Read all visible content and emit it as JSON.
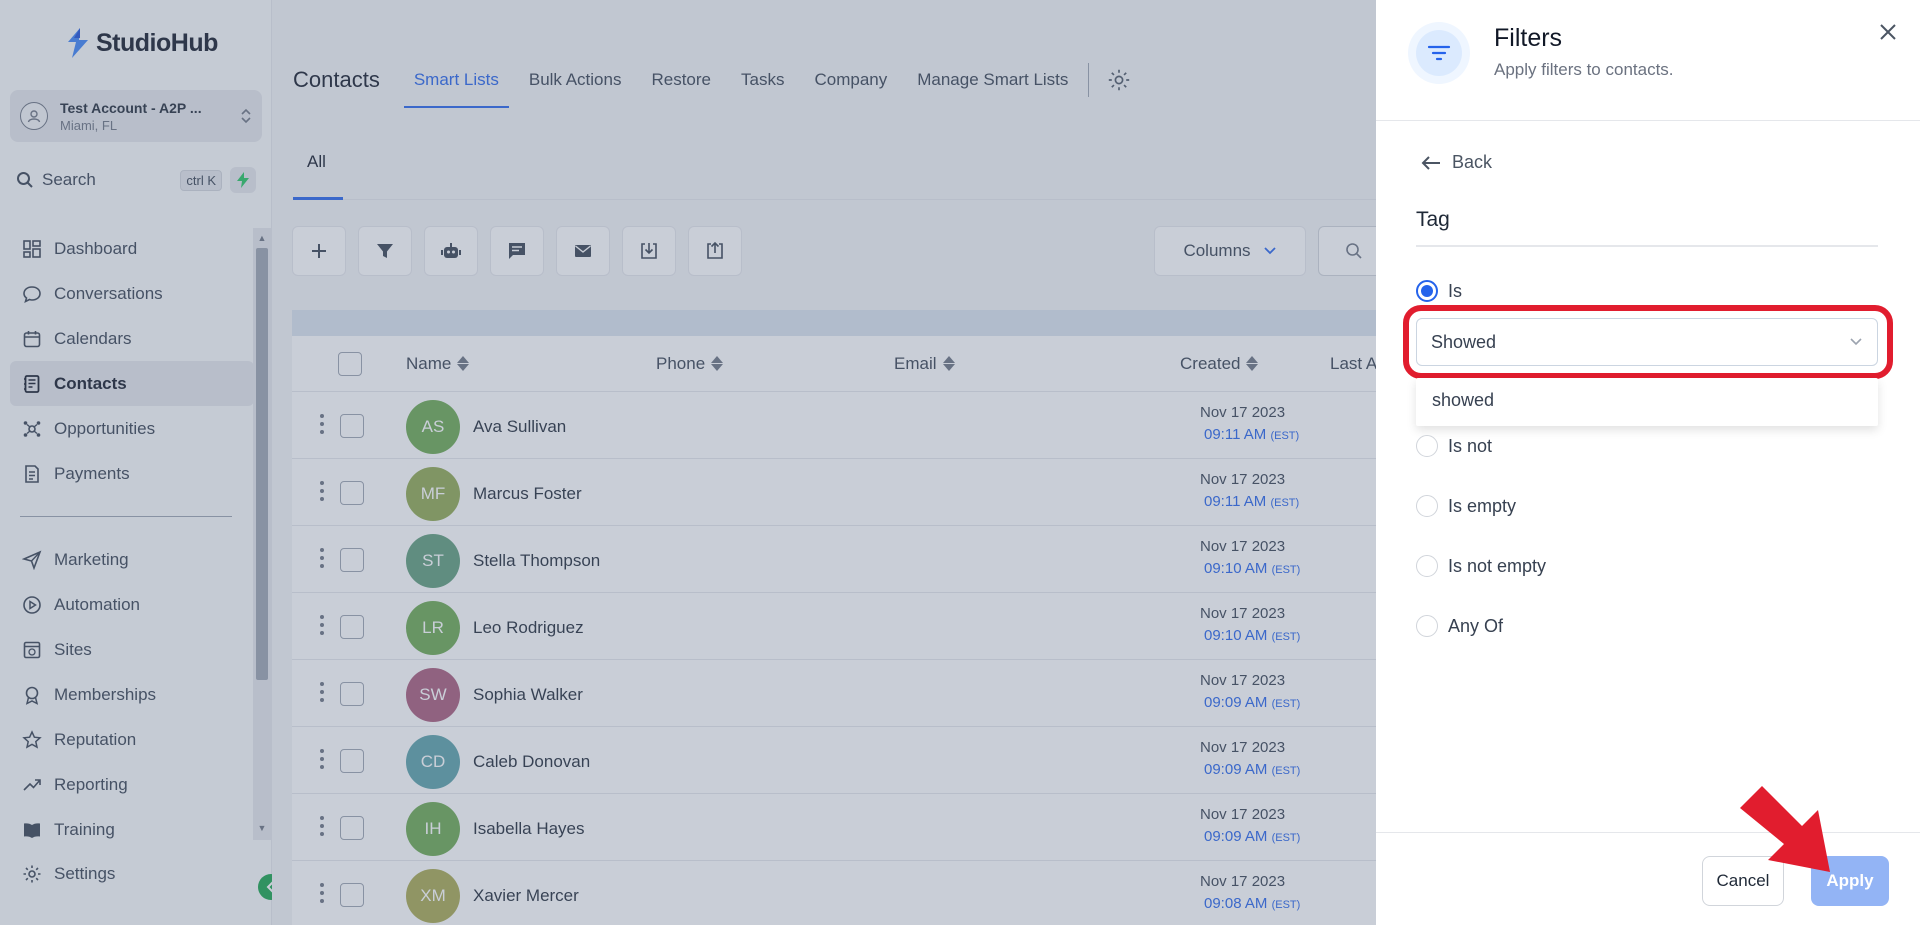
{
  "app": {
    "brand": "StudioHub"
  },
  "account": {
    "name": "Test Account - A2P ...",
    "location": "Miami, FL"
  },
  "search": {
    "label": "Search",
    "shortcut": "ctrl K"
  },
  "sidebar": {
    "items": [
      {
        "label": "Dashboard",
        "icon": "dashboard-icon"
      },
      {
        "label": "Conversations",
        "icon": "chat-bubble-icon"
      },
      {
        "label": "Calendars",
        "icon": "calendar-icon"
      },
      {
        "label": "Contacts",
        "icon": "contacts-book-icon",
        "active": true
      },
      {
        "label": "Opportunities",
        "icon": "opportunities-icon"
      },
      {
        "label": "Payments",
        "icon": "payments-icon"
      }
    ],
    "items2": [
      {
        "label": "Marketing",
        "icon": "send-icon"
      },
      {
        "label": "Automation",
        "icon": "automation-icon"
      },
      {
        "label": "Sites",
        "icon": "sites-icon"
      },
      {
        "label": "Memberships",
        "icon": "memberships-icon"
      },
      {
        "label": "Reputation",
        "icon": "star-icon"
      },
      {
        "label": "Reporting",
        "icon": "trend-icon"
      },
      {
        "label": "Training",
        "icon": "book-icon"
      }
    ],
    "settings": "Settings"
  },
  "topbar": {
    "title": "Contacts",
    "tabs": [
      "Smart Lists",
      "Bulk Actions",
      "Restore",
      "Tasks",
      "Company",
      "Manage Smart Lists"
    ]
  },
  "subtabs": {
    "all": "All"
  },
  "toolbar": {
    "columns": "Columns"
  },
  "table": {
    "headers": {
      "name": "Name",
      "phone": "Phone",
      "email": "Email",
      "created": "Created",
      "last": "Last Acti"
    },
    "rows": [
      {
        "initials": "AS",
        "name": "Ava Sullivan",
        "date": "Nov 17 2023",
        "time": "09:11 AM",
        "tz": "(EST)",
        "color": "#6aa84f"
      },
      {
        "initials": "MF",
        "name": "Marcus Foster",
        "date": "Nov 17 2023",
        "time": "09:11 AM",
        "tz": "(EST)",
        "color": "#8fa84f"
      },
      {
        "initials": "ST",
        "name": "Stella Thompson",
        "date": "Nov 17 2023",
        "time": "09:10 AM",
        "tz": "(EST)",
        "color": "#5e9c7a"
      },
      {
        "initials": "LR",
        "name": "Leo Rodriguez",
        "date": "Nov 17 2023",
        "time": "09:10 AM",
        "tz": "(EST)",
        "color": "#6aa84f"
      },
      {
        "initials": "SW",
        "name": "Sophia Walker",
        "date": "Nov 17 2023",
        "time": "09:09 AM",
        "tz": "(EST)",
        "color": "#a85a7a"
      },
      {
        "initials": "CD",
        "name": "Caleb Donovan",
        "date": "Nov 17 2023",
        "time": "09:09 AM",
        "tz": "(EST)",
        "color": "#5aa0a8"
      },
      {
        "initials": "IH",
        "name": "Isabella Hayes",
        "date": "Nov 17 2023",
        "time": "09:09 AM",
        "tz": "(EST)",
        "color": "#6aa84f"
      },
      {
        "initials": "XM",
        "name": "Xavier Mercer",
        "date": "Nov 17 2023",
        "time": "09:08 AM",
        "tz": "(EST)",
        "color": "#a8a84f"
      }
    ]
  },
  "filters": {
    "title": "Filters",
    "subtitle": "Apply filters to contacts.",
    "back": "Back",
    "field": "Tag",
    "options": [
      "Is",
      "Is not",
      "Is empty",
      "Is not empty",
      "Any Of"
    ],
    "selected_value": "Showed",
    "dropdown_option": "showed",
    "cancel": "Cancel",
    "apply": "Apply"
  },
  "colors": {
    "accent": "#2563eb",
    "highlight": "#e11d2e",
    "apply_disabled": "#93b4f5"
  }
}
